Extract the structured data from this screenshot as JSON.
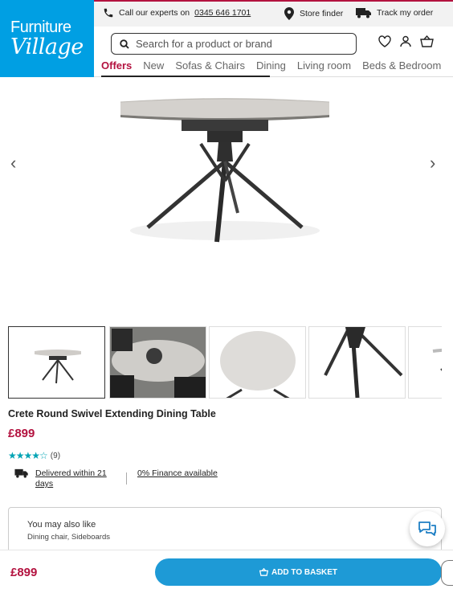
{
  "brand": {
    "line1": "Furniture",
    "line2": "Village"
  },
  "utility": {
    "call_label": "Call our experts on",
    "phone": "0345 646 1701",
    "store_finder": "Store finder",
    "track_order": "Track my order"
  },
  "search": {
    "placeholder": "Search for a product or brand"
  },
  "nav": {
    "items": [
      "Offers",
      "New",
      "Sofas & Chairs",
      "Dining",
      "Living room",
      "Beds & Bedroom"
    ]
  },
  "gallery": {
    "prev": "‹",
    "next": "›"
  },
  "product": {
    "title": "Crete Round Swivel Extending Dining Table",
    "price": "£899",
    "rating_value": 4.5,
    "review_count": "(9)",
    "delivery": "Delivered within 21 days",
    "finance": "0% Finance available"
  },
  "also_like": {
    "heading": "You may also like",
    "items": "Dining chair, Sideboards"
  },
  "footer": {
    "price": "£899",
    "cta": "ADD TO BASKET"
  },
  "colors": {
    "brand_blue": "#009fe3",
    "accent_red": "#b3123f",
    "cta_blue": "#1e9ad6",
    "star_teal": "#00a3b4"
  }
}
